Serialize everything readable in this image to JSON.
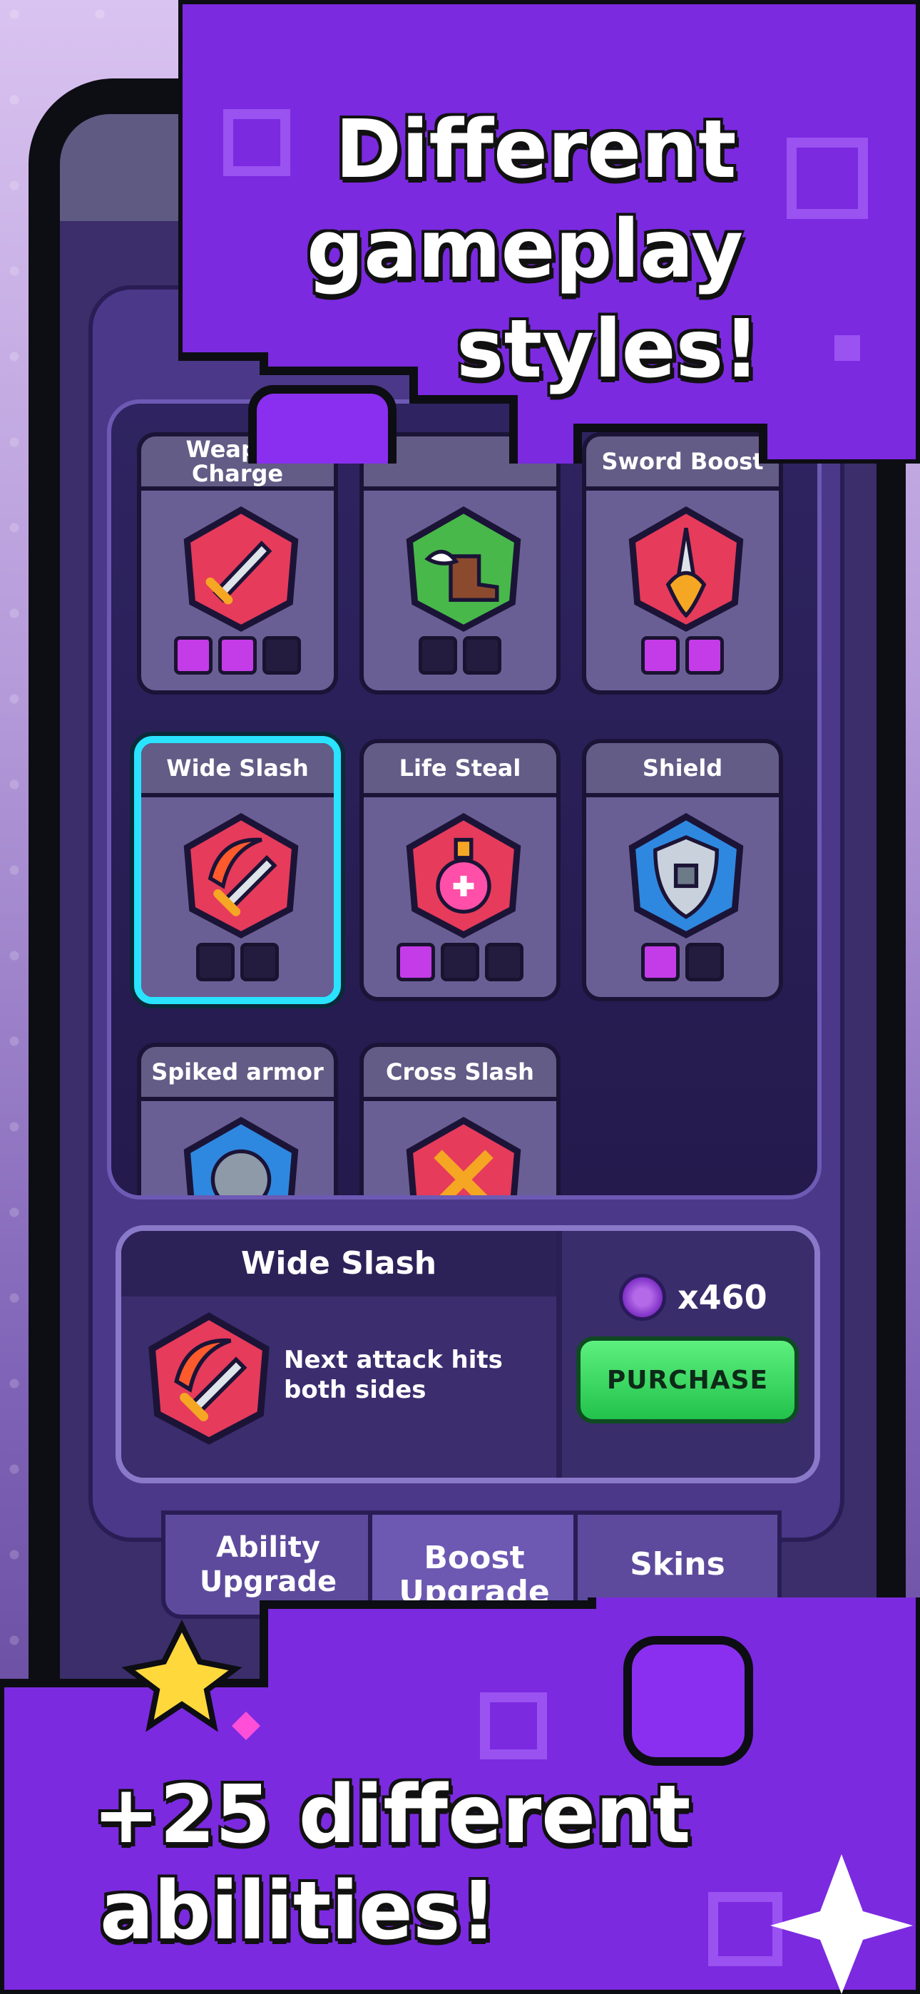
{
  "banners": {
    "top_lines": [
      "Different",
      "gameplay",
      "styles!"
    ],
    "bottom_lines": [
      "+25 different",
      "abilities!"
    ]
  },
  "cards": [
    {
      "label": "Weapon Charge",
      "icon": "sword-icon",
      "pips": [
        true,
        true,
        false
      ],
      "color": "#e63b5b"
    },
    {
      "label": "",
      "icon": "winged-boot-icon",
      "pips": [
        false,
        false
      ],
      "color": "#48b84a"
    },
    {
      "label": "Sword Boost",
      "icon": "flaming-sword-icon",
      "pips": [
        true,
        true
      ],
      "color": "#e63b5b"
    },
    {
      "label": "Wide Slash",
      "icon": "slash-sword-icon",
      "pips": [
        false,
        false
      ],
      "color": "#e63b5b",
      "selected": true
    },
    {
      "label": "Life Steal",
      "icon": "potion-icon",
      "pips": [
        true,
        false,
        false
      ],
      "color": "#e63b5b"
    },
    {
      "label": "Shield",
      "icon": "shield-icon",
      "pips": [
        true,
        false
      ],
      "color": "#2f88e0"
    },
    {
      "label": "Spiked armor",
      "icon": "armor-icon",
      "pips": [],
      "color": "#2f88e0"
    },
    {
      "label": "Cross Slash",
      "icon": "cross-sword-icon",
      "pips": [],
      "color": "#e63b5b"
    }
  ],
  "detail": {
    "title": "Wide Slash",
    "description": "Next attack hits both sides",
    "price": "x460",
    "purchase_label": "PURCHASE"
  },
  "tabs": [
    {
      "label": "Ability Upgrade"
    },
    {
      "label": "Boost Upgrade"
    },
    {
      "label": "Skins"
    }
  ]
}
